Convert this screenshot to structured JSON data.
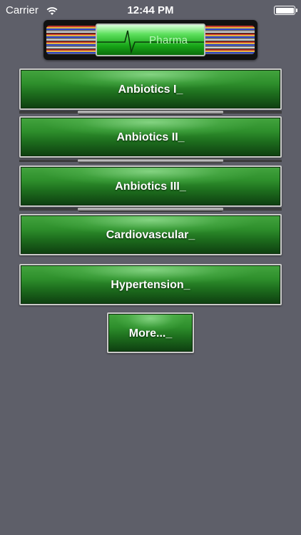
{
  "status_bar": {
    "carrier": "Carrier",
    "time": "12:44 PM",
    "wifi_icon": "wifi-icon",
    "battery_icon": "battery-full-icon"
  },
  "header": {
    "brand": "Pharma",
    "icon": "ecg-heartbeat-icon"
  },
  "menu": {
    "items": [
      {
        "label": "Anbiotics I_"
      },
      {
        "label": "Anbiotics II_"
      },
      {
        "label": "Anbiotics III_"
      },
      {
        "label": "Cardiovascular_"
      },
      {
        "label": "Hypertension_"
      },
      {
        "label": "More..._"
      }
    ]
  },
  "colors": {
    "background": "#5e5f69",
    "button_green": "#2e8f2c",
    "button_border": "#c9cac8"
  }
}
